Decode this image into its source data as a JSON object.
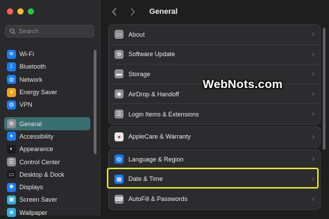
{
  "colors": {
    "close": "#ff5f57",
    "minimize": "#febc2e",
    "zoom": "#28c840",
    "active_item": "#3a6f71",
    "highlight_border": "#e8e83a"
  },
  "search": {
    "placeholder": "Search",
    "icon": "magnifier-icon"
  },
  "sidebar": {
    "items": [
      {
        "label": "Wi-Fi",
        "icon": "wifi-icon",
        "color": "#1a7cf5",
        "glyph": "≋"
      },
      {
        "label": "Bluetooth",
        "icon": "bluetooth-icon",
        "color": "#1a7cf5",
        "glyph": "ᛒ"
      },
      {
        "label": "Network",
        "icon": "globe-icon",
        "color": "#1a7cf5",
        "glyph": "◍"
      },
      {
        "label": "Energy Saver",
        "icon": "lightbulb-icon",
        "color": "#f5a31a",
        "glyph": "●"
      },
      {
        "label": "VPN",
        "icon": "vpn-globe-icon",
        "color": "#1a7cf5",
        "glyph": "◍"
      },
      {
        "label": "General",
        "icon": "gear-icon",
        "color": "#8e8e93",
        "glyph": "⚙"
      },
      {
        "label": "Accessibility",
        "icon": "accessibility-icon",
        "color": "#1a7cf5",
        "glyph": "✦"
      },
      {
        "label": "Appearance",
        "icon": "appearance-icon",
        "color": "#1c1c1e",
        "glyph": "◐"
      },
      {
        "label": "Control Center",
        "icon": "control-center-icon",
        "color": "#8e8e93",
        "glyph": "☰"
      },
      {
        "label": "Desktop & Dock",
        "icon": "dock-icon",
        "color": "#1c1c1e",
        "glyph": "▭"
      },
      {
        "label": "Displays",
        "icon": "displays-icon",
        "color": "#1a7cf5",
        "glyph": "✺"
      },
      {
        "label": "Screen Saver",
        "icon": "screen-saver-icon",
        "color": "#34aadc",
        "glyph": "▣"
      },
      {
        "label": "Wallpaper",
        "icon": "wallpaper-icon",
        "color": "#34aadc",
        "glyph": "❀"
      }
    ]
  },
  "header": {
    "title": "General"
  },
  "main": {
    "group1": [
      {
        "label": "About",
        "icon": "laptop-icon",
        "color": "#8e8e93",
        "glyph": "▭"
      },
      {
        "label": "Software Update",
        "icon": "software-update-icon",
        "color": "#8e8e93",
        "glyph": "⚙"
      },
      {
        "label": "Storage",
        "icon": "storage-icon",
        "color": "#8e8e93",
        "glyph": "▬"
      },
      {
        "label": "AirDrop & Handoff",
        "icon": "airdrop-icon",
        "color": "#8e8e93",
        "glyph": "◉"
      },
      {
        "label": "Login Items & Extensions",
        "icon": "login-items-icon",
        "color": "#8e8e93",
        "glyph": "☰"
      }
    ],
    "group2": [
      {
        "label": "AppleCare & Warranty",
        "icon": "apple-icon",
        "color": "#e8e8ea",
        "glyph": "●"
      }
    ],
    "group3": [
      {
        "label": "Language & Region",
        "icon": "language-globe-icon",
        "color": "#1a7cf5",
        "glyph": "◍"
      },
      {
        "label": "Date & Time",
        "icon": "calendar-clock-icon",
        "color": "#1a7cf5",
        "glyph": "▦"
      },
      {
        "label": "AutoFill & Passwords",
        "icon": "autofill-key-icon",
        "color": "#8e8e93",
        "glyph": "⌨"
      }
    ]
  },
  "watermark": "WebNots.com"
}
